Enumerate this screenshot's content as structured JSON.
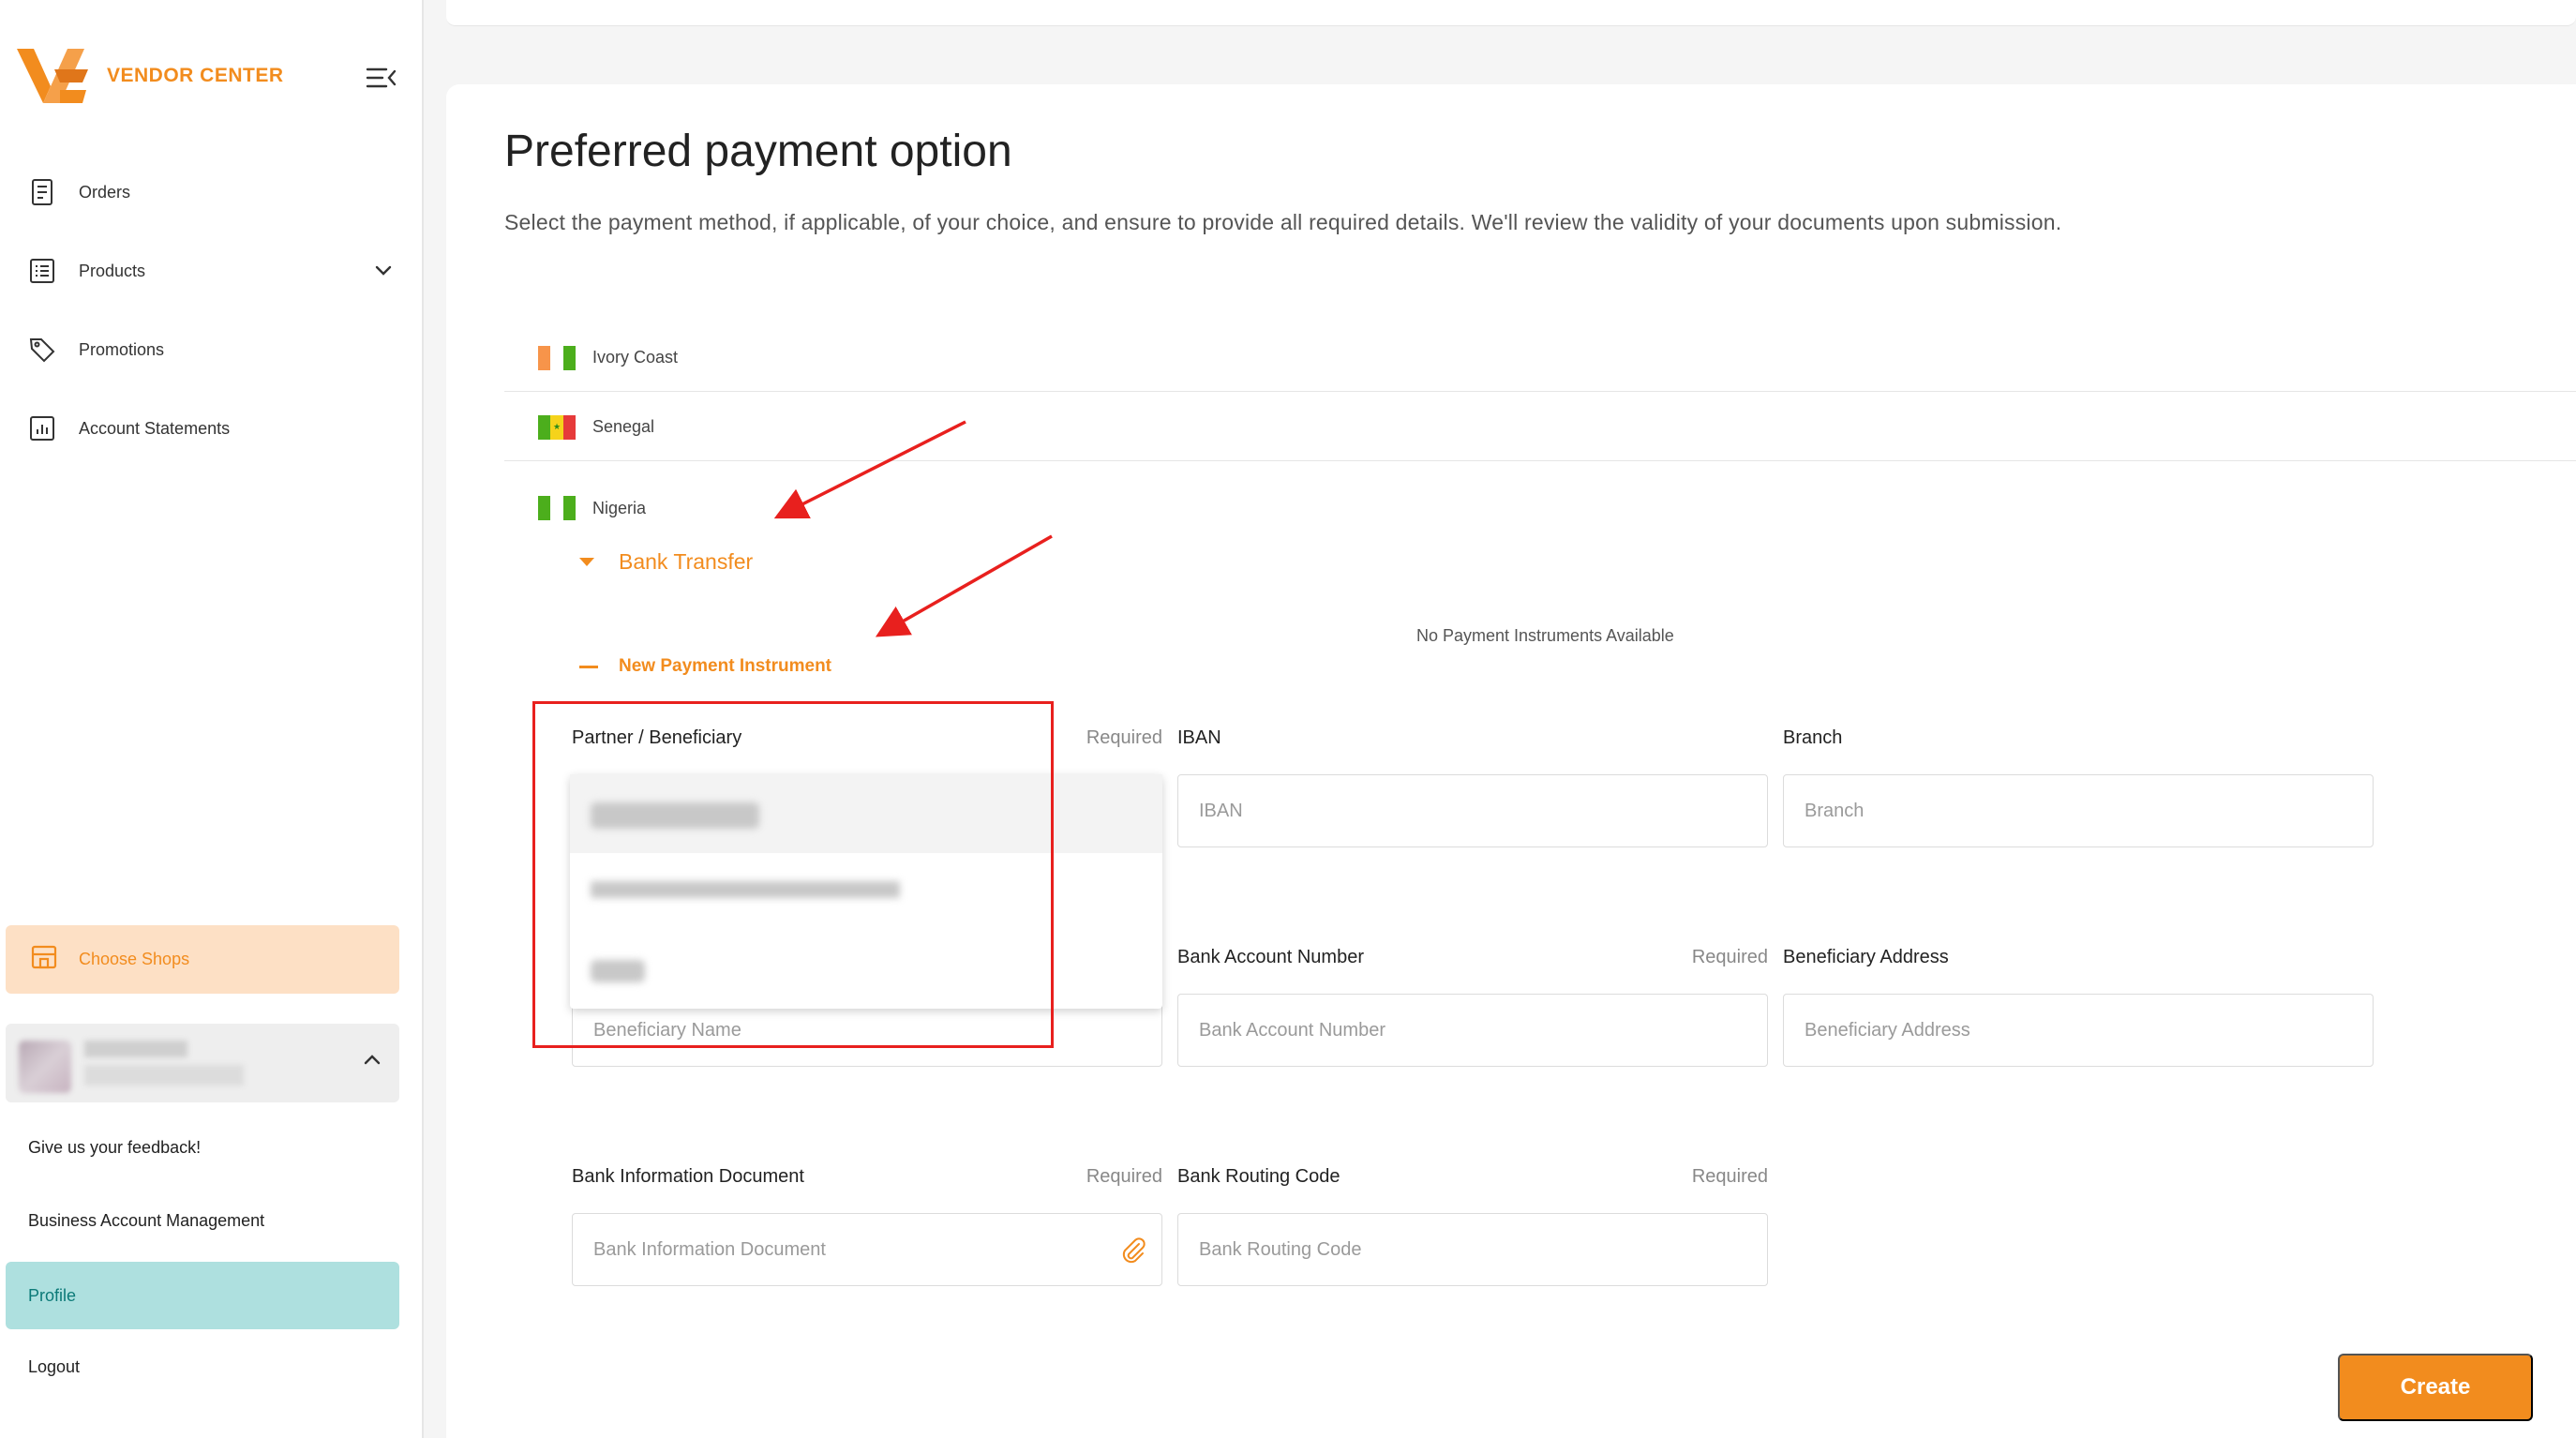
{
  "brand": {
    "name": "VENDOR CENTER",
    "accent": "#f28c1e"
  },
  "sidebar": {
    "items": [
      {
        "label": "Orders",
        "icon": "receipt-icon"
      },
      {
        "label": "Products",
        "icon": "list-icon",
        "expandable": true
      },
      {
        "label": "Promotions",
        "icon": "tag-icon"
      },
      {
        "label": "Account Statements",
        "icon": "chart-icon"
      }
    ],
    "choose_shops": "Choose Shops",
    "links": {
      "feedback": "Give us your feedback!",
      "business": "Business Account Management",
      "profile": "Profile",
      "logout": "Logout"
    }
  },
  "main": {
    "title": "Preferred payment option",
    "description": "Select the payment method, if applicable, of your choice, and ensure to provide all required details. We'll review the validity of your documents upon submission.",
    "countries": [
      "Ivory Coast",
      "Senegal",
      "Nigeria"
    ],
    "method": "Bank Transfer",
    "no_instruments": "No Payment Instruments Available",
    "new_instrument": "New Payment Instrument",
    "fields": {
      "partner": {
        "label": "Partner / Beneficiary",
        "required": "Required"
      },
      "iban": {
        "label": "IBAN",
        "placeholder": "IBAN"
      },
      "branch": {
        "label": "Branch",
        "placeholder": "Branch"
      },
      "beneficiary_name": {
        "placeholder": "Beneficiary Name"
      },
      "bank_account_number": {
        "label": "Bank Account Number",
        "required": "Required",
        "placeholder": "Bank Account Number"
      },
      "beneficiary_address": {
        "label": "Beneficiary Address",
        "placeholder": "Beneficiary Address"
      },
      "bank_info_doc": {
        "label": "Bank Information Document",
        "required": "Required",
        "placeholder": "Bank Information Document"
      },
      "bank_routing_code": {
        "label": "Bank Routing Code",
        "required": "Required",
        "placeholder": "Bank Routing Code"
      }
    },
    "create_button": "Create"
  }
}
